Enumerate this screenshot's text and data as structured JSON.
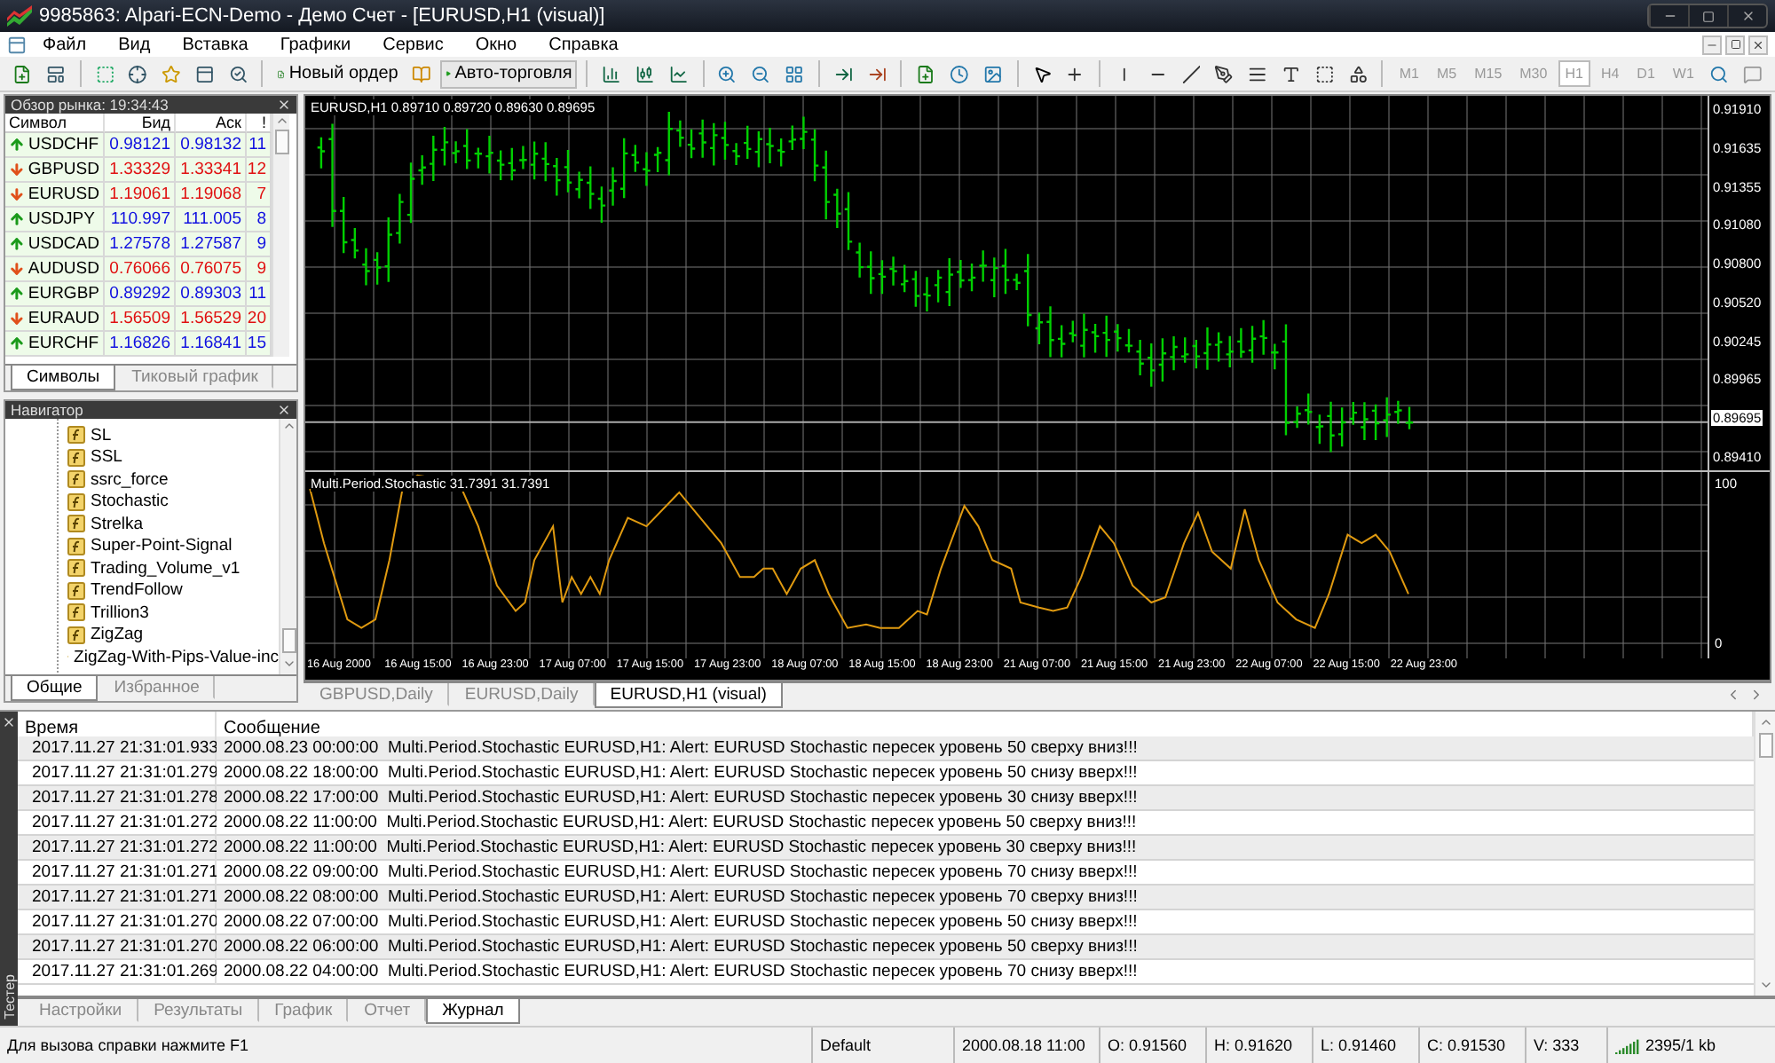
{
  "window": {
    "title": "9985863: Alpari-ECN-Demo - Демо Счет - [EURUSD,H1 (visual)]"
  },
  "menu": [
    "Файл",
    "Вид",
    "Вставка",
    "Графики",
    "Сервис",
    "Окно",
    "Справка"
  ],
  "toolbar": {
    "new_order": "Новый ордер",
    "auto_trading": "Авто-торговля",
    "timeframes": [
      {
        "label": "M1",
        "selected": false
      },
      {
        "label": "M5",
        "selected": false
      },
      {
        "label": "M15",
        "selected": false
      },
      {
        "label": "M30",
        "selected": false
      },
      {
        "label": "H1",
        "selected": true
      },
      {
        "label": "H4",
        "selected": false
      },
      {
        "label": "D1",
        "selected": false
      },
      {
        "label": "W1",
        "selected": false
      }
    ]
  },
  "market_watch": {
    "title": "Обзор рынка: 19:34:43",
    "columns": [
      "Символ",
      "Бид",
      "Аск",
      "!"
    ],
    "rows": [
      {
        "symbol": "USDCHF",
        "bid": "0.98121",
        "ask": "0.98132",
        "spread": "11",
        "rising": true
      },
      {
        "symbol": "GBPUSD",
        "bid": "1.33329",
        "ask": "1.33341",
        "spread": "12",
        "rising": false
      },
      {
        "symbol": "EURUSD",
        "bid": "1.19061",
        "ask": "1.19068",
        "spread": "7",
        "rising": false
      },
      {
        "symbol": "USDJPY",
        "bid": "110.997",
        "ask": "111.005",
        "spread": "8",
        "rising": true
      },
      {
        "symbol": "USDCAD",
        "bid": "1.27578",
        "ask": "1.27587",
        "spread": "9",
        "rising": true
      },
      {
        "symbol": "AUDUSD",
        "bid": "0.76066",
        "ask": "0.76075",
        "spread": "9",
        "rising": false
      },
      {
        "symbol": "EURGBP",
        "bid": "0.89292",
        "ask": "0.89303",
        "spread": "11",
        "rising": true
      },
      {
        "symbol": "EURAUD",
        "bid": "1.56509",
        "ask": "1.56529",
        "spread": "20",
        "rising": false
      },
      {
        "symbol": "EURCHF",
        "bid": "1.16826",
        "ask": "1.16841",
        "spread": "15",
        "rising": true
      }
    ],
    "tabs": [
      {
        "label": "Символы",
        "selected": true
      },
      {
        "label": "Тиковый график",
        "selected": false
      }
    ]
  },
  "navigator": {
    "title": "Навигатор",
    "items": [
      "SL",
      "SSL",
      "ssrc_force",
      "Stochastic",
      "Strelka",
      "Super-Point-Signal",
      "Trading_Volume_v1",
      "TrendFollow",
      "Trillion3",
      "ZigZag",
      "ZigZag-With-Pips-Value-inc"
    ],
    "tabs": [
      {
        "label": "Общие",
        "selected": true
      },
      {
        "label": "Избранное",
        "selected": false
      }
    ]
  },
  "chart": {
    "info": "EURUSD,H1 0.89710 0.89720 0.89630 0.89695",
    "indicator": "Multi.Period.Stochastic 31.7391 31.7391",
    "price_axis": [
      {
        "label": "0.91910",
        "kind": "tick"
      },
      {
        "label": "0.91635",
        "kind": "tick"
      },
      {
        "label": "0.91355",
        "kind": "tick"
      },
      {
        "label": "0.91080",
        "kind": "tick"
      },
      {
        "label": "0.90800",
        "kind": "tick"
      },
      {
        "label": "0.90520",
        "kind": "tick"
      },
      {
        "label": "0.90245",
        "kind": "tick"
      },
      {
        "label": "0.89965",
        "kind": "tick"
      },
      {
        "label": "0.89695",
        "kind": "current"
      },
      {
        "label": "0.89410",
        "kind": "tick"
      }
    ],
    "indicator_axis": [
      "100",
      "0"
    ],
    "time_axis": [
      "16 Aug 2000",
      "16 Aug 15:00",
      "16 Aug 23:00",
      "17 Aug 07:00",
      "17 Aug 15:00",
      "17 Aug 23:00",
      "18 Aug 07:00",
      "18 Aug 15:00",
      "18 Aug 23:00",
      "21 Aug 07:00",
      "21 Aug 15:00",
      "21 Aug 23:00",
      "22 Aug 07:00",
      "22 Aug 15:00",
      "22 Aug 23:00"
    ],
    "tabs": [
      {
        "label": "GBPUSD,Daily",
        "selected": false
      },
      {
        "label": "EURUSD,Daily",
        "selected": false
      },
      {
        "label": "EURUSD,H1 (visual)",
        "selected": true
      }
    ]
  },
  "terminal": {
    "title": "Тестер",
    "columns": [
      "Время",
      "Сообщение"
    ],
    "rows": [
      {
        "time": "2017.11.27 21:31:01.933",
        "message": "2000.08.23 00:00:00  Multi.Period.Stochastic EURUSD,H1: Alert: EURUSD Stochastic пересек уровень 50 сверху вниз!!!"
      },
      {
        "time": "2017.11.27 21:31:01.279",
        "message": "2000.08.22 18:00:00  Multi.Period.Stochastic EURUSD,H1: Alert: EURUSD Stochastic пересек уровень 50 снизу вверх!!!"
      },
      {
        "time": "2017.11.27 21:31:01.278",
        "message": "2000.08.22 17:00:00  Multi.Period.Stochastic EURUSD,H1: Alert: EURUSD Stochastic пересек уровень 30 снизу вверх!!!"
      },
      {
        "time": "2017.11.27 21:31:01.272",
        "message": "2000.08.22 11:00:00  Multi.Period.Stochastic EURUSD,H1: Alert: EURUSD Stochastic пересек уровень 50 сверху вниз!!!"
      },
      {
        "time": "2017.11.27 21:31:01.272",
        "message": "2000.08.22 11:00:00  Multi.Period.Stochastic EURUSD,H1: Alert: EURUSD Stochastic пересек уровень 30 сверху вниз!!!"
      },
      {
        "time": "2017.11.27 21:31:01.271",
        "message": "2000.08.22 09:00:00  Multi.Period.Stochastic EURUSD,H1: Alert: EURUSD Stochastic пересек уровень 70 снизу вверх!!!"
      },
      {
        "time": "2017.11.27 21:31:01.271",
        "message": "2000.08.22 08:00:00  Multi.Period.Stochastic EURUSD,H1: Alert: EURUSD Stochastic пересек уровень 70 сверху вниз!!!"
      },
      {
        "time": "2017.11.27 21:31:01.270",
        "message": "2000.08.22 07:00:00  Multi.Period.Stochastic EURUSD,H1: Alert: EURUSD Stochastic пересек уровень 50 снизу вверх!!!"
      },
      {
        "time": "2017.11.27 21:31:01.270",
        "message": "2000.08.22 06:00:00  Multi.Period.Stochastic EURUSD,H1: Alert: EURUSD Stochastic пересек уровень 50 сверху вниз!!!"
      },
      {
        "time": "2017.11.27 21:31:01.269",
        "message": "2000.08.22 04:00:00  Multi.Period.Stochastic EURUSD,H1: Alert: EURUSD Stochastic пересек уровень 70 снизу вверх!!!"
      }
    ],
    "tabs": [
      {
        "label": "Настройки",
        "selected": false
      },
      {
        "label": "Результаты",
        "selected": false
      },
      {
        "label": "График",
        "selected": false
      },
      {
        "label": "Отчет",
        "selected": false
      },
      {
        "label": "Журнал",
        "selected": true
      }
    ]
  },
  "status_bar": {
    "help": "Для вызова справки нажмите F1",
    "profile": "Default",
    "date": "2000.08.18 11:00",
    "open": "O: 0.91560",
    "high": "H: 0.91620",
    "low": "L: 0.91460",
    "close": "C: 0.91530",
    "volume": "V: 333",
    "traffic": "2395/1 kb"
  }
}
